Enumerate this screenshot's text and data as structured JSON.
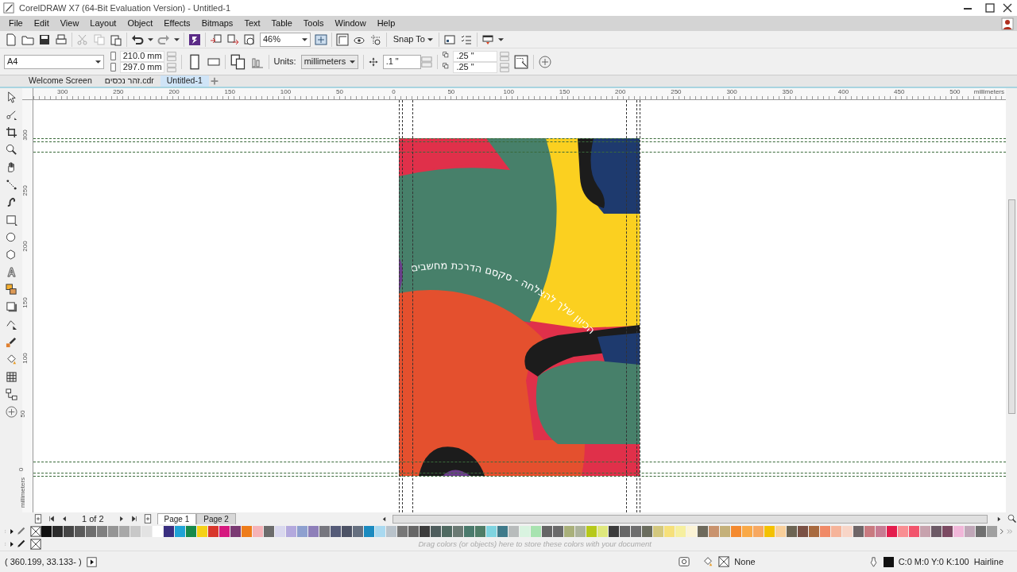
{
  "window": {
    "title": "CorelDRAW X7 (64-Bit Evaluation Version) - Untitled-1"
  },
  "menu": [
    "File",
    "Edit",
    "View",
    "Layout",
    "Object",
    "Effects",
    "Bitmaps",
    "Text",
    "Table",
    "Tools",
    "Window",
    "Help"
  ],
  "toolbar": {
    "zoom": "46%",
    "snap": "Snap To"
  },
  "property_bar": {
    "page_size": "A4",
    "width": "210.0 mm",
    "height": "297.0 mm",
    "units_label": "Units:",
    "units": "millimeters",
    "nudge": ".1 \"",
    "duplicate_x": ".25 \"",
    "duplicate_y": ".25 \""
  },
  "document_tabs": [
    {
      "label": "Welcome Screen",
      "selected": false
    },
    {
      "label": "זהר נכסים.cdr",
      "selected": false
    },
    {
      "label": "Untitled-1",
      "selected": true
    }
  ],
  "rulers": {
    "horizontal": [
      "300",
      "250",
      "200",
      "150",
      "100",
      "50",
      "0",
      "50",
      "100",
      "150",
      "200",
      "250",
      "300",
      "350",
      "400",
      "450",
      "500"
    ],
    "horizontal_unit": "millimeters",
    "vertical": [
      "300",
      "250",
      "200",
      "150",
      "100",
      "50",
      "0"
    ],
    "vertical_unit": "millimeters"
  },
  "artwork": {
    "curved_text": "הכיוון שלך להצלחה - סקסם הדרכת מחשבים"
  },
  "page_navigator": {
    "position": "1 of 2",
    "pages": [
      {
        "label": "Page 1",
        "selected": true
      },
      {
        "label": "Page 2",
        "selected": false
      }
    ]
  },
  "palette": {
    "colors": [
      {
        "color": "#111111"
      },
      {
        "color": "#2b2b2b"
      },
      {
        "color": "#454545"
      },
      {
        "color": "#5a5a5a"
      },
      {
        "color": "#6e6e6e"
      },
      {
        "color": "#808080"
      },
      {
        "color": "#959595"
      },
      {
        "color": "#a8a8a8"
      },
      {
        "color": "#c8c8c8"
      },
      {
        "color": "#e3e3e3"
      },
      {
        "color": "#ffffff"
      },
      {
        "color": "#3a2f80"
      },
      {
        "color": "#1fa3d6"
      },
      {
        "color": "#178a4c"
      },
      {
        "color": "#f5d117"
      },
      {
        "color": "#d8372c"
      },
      {
        "color": "#d6197f"
      },
      {
        "color": "#7b3a73"
      },
      {
        "color": "#ee7d1b"
      },
      {
        "color": "#f5b3b8"
      },
      {
        "color": "#6c6c6c"
      },
      {
        "color": "#d9d8ee"
      },
      {
        "color": "#b3a9dd"
      },
      {
        "color": "#8ea0cf"
      },
      {
        "color": "#8e7fb9"
      },
      {
        "color": "#77777f"
      },
      {
        "color": "#555b78"
      },
      {
        "color": "#4d5366"
      },
      {
        "color": "#667080"
      },
      {
        "color": "#1b8bc0"
      },
      {
        "color": "#a9d9f0"
      },
      {
        "color": "#b9c3cb"
      },
      {
        "color": "#777777"
      },
      {
        "color": "#666666"
      },
      {
        "color": "#3c3c3c"
      },
      {
        "color": "#4f5e5e"
      },
      {
        "color": "#506a62"
      },
      {
        "color": "#6b7a74"
      },
      {
        "color": "#4a7a6c"
      },
      {
        "color": "#4f7d67"
      },
      {
        "color": "#7fd4e0"
      },
      {
        "color": "#3f7a8a"
      },
      {
        "color": "#b8bcbc"
      },
      {
        "color": "#d9f3e0"
      },
      {
        "color": "#a8e3b0"
      },
      {
        "color": "#666666"
      },
      {
        "color": "#6b6b6b"
      },
      {
        "color": "#a9b07a"
      },
      {
        "color": "#acb39c"
      },
      {
        "color": "#b6c91a"
      },
      {
        "color": "#dfe87d"
      },
      {
        "color": "#3c3c3c"
      },
      {
        "color": "#666666"
      },
      {
        "color": "#6e6e6e"
      },
      {
        "color": "#6b6d5e"
      },
      {
        "color": "#d3c87e"
      },
      {
        "color": "#f6e07a"
      },
      {
        "color": "#f6ef9e"
      },
      {
        "color": "#fbf3d5"
      },
      {
        "color": "#6e6a5c"
      },
      {
        "color": "#c9936e"
      },
      {
        "color": "#c4b07a"
      },
      {
        "color": "#f48a2f"
      },
      {
        "color": "#f9a947"
      },
      {
        "color": "#f7a860"
      },
      {
        "color": "#f4c100"
      },
      {
        "color": "#f8cf9a"
      },
      {
        "color": "#6d6553"
      },
      {
        "color": "#7b5144"
      },
      {
        "color": "#a86a3f"
      },
      {
        "color": "#f08a67"
      },
      {
        "color": "#f6b49a"
      },
      {
        "color": "#f8d5c7"
      },
      {
        "color": "#6f6668"
      },
      {
        "color": "#c97a80"
      },
      {
        "color": "#c87c93"
      },
      {
        "color": "#e41d4d"
      },
      {
        "color": "#f98e92"
      },
      {
        "color": "#f2556d"
      },
      {
        "color": "#c7a2ad"
      },
      {
        "color": "#6d5a66"
      },
      {
        "color": "#7c4a62"
      },
      {
        "color": "#f1b7d9"
      },
      {
        "color": "#c0a7b8"
      },
      {
        "color": "#707070"
      },
      {
        "color": "#a0a0a0"
      }
    ]
  },
  "document_palette": {
    "hint": "Drag colors (or objects) here to store these colors with your document"
  },
  "status_bar": {
    "coordinates": "( 360.199, 33.133- )",
    "fill": "None",
    "outline_color": "C:0 M:0 Y:0 K:100",
    "outline_width": "Hairline"
  }
}
